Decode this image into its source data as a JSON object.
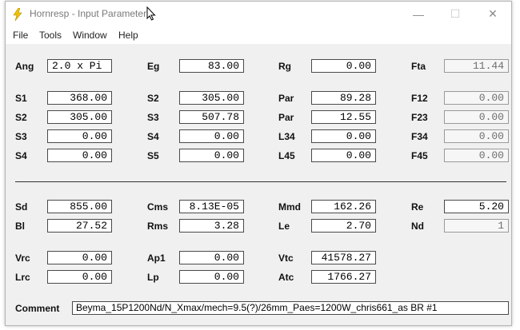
{
  "window": {
    "title": "Hornresp - Input Parameters",
    "controls": {
      "minimize": "—",
      "maximize": "☐",
      "close": "✕"
    },
    "accent": "#f2c200"
  },
  "menu": {
    "file": "File",
    "tools": "Tools",
    "window": "Window",
    "help": "Help"
  },
  "params": {
    "Ang": {
      "label": "Ang",
      "value": "2.0 x Pi"
    },
    "Eg": {
      "label": "Eg",
      "value": "83.00"
    },
    "Rg": {
      "label": "Rg",
      "value": "0.00"
    },
    "Fta": {
      "label": "Fta",
      "value": "11.44"
    },
    "S1": {
      "label": "S1",
      "value": "368.00"
    },
    "S2a": {
      "label": "S2",
      "value": "305.00"
    },
    "Par1": {
      "label": "Par",
      "value": "89.28"
    },
    "F12": {
      "label": "F12",
      "value": "0.00"
    },
    "S2b": {
      "label": "S2",
      "value": "305.00"
    },
    "S3a": {
      "label": "S3",
      "value": "507.78"
    },
    "Par2": {
      "label": "Par",
      "value": "12.55"
    },
    "F23": {
      "label": "F23",
      "value": "0.00"
    },
    "S3b": {
      "label": "S3",
      "value": "0.00"
    },
    "S4a": {
      "label": "S4",
      "value": "0.00"
    },
    "L34": {
      "label": "L34",
      "value": "0.00"
    },
    "F34": {
      "label": "F34",
      "value": "0.00"
    },
    "S4b": {
      "label": "S4",
      "value": "0.00"
    },
    "S5": {
      "label": "S5",
      "value": "0.00"
    },
    "L45": {
      "label": "L45",
      "value": "0.00"
    },
    "F45": {
      "label": "F45",
      "value": "0.00"
    },
    "Sd": {
      "label": "Sd",
      "value": "855.00"
    },
    "Cms": {
      "label": "Cms",
      "value": "8.13E-05"
    },
    "Mmd": {
      "label": "Mmd",
      "value": "162.26"
    },
    "Re": {
      "label": "Re",
      "value": "5.20"
    },
    "Bl": {
      "label": "Bl",
      "value": "27.52"
    },
    "Rms": {
      "label": "Rms",
      "value": "3.28"
    },
    "Le": {
      "label": "Le",
      "value": "2.70"
    },
    "Nd": {
      "label": "Nd",
      "value": "1"
    },
    "Vrc": {
      "label": "Vrc",
      "value": "0.00"
    },
    "Ap1": {
      "label": "Ap1",
      "value": "0.00"
    },
    "Vtc": {
      "label": "Vtc",
      "value": "41578.27"
    },
    "Lrc": {
      "label": "Lrc",
      "value": "0.00"
    },
    "Lp": {
      "label": "Lp",
      "value": "0.00"
    },
    "Atc": {
      "label": "Atc",
      "value": "1766.27"
    }
  },
  "comment": {
    "label": "Comment",
    "value": "Beyma_15P1200Nd/N_Xmax/mech=9.5(?)/26mm_Paes=1200W_chris661_as BR #1"
  }
}
